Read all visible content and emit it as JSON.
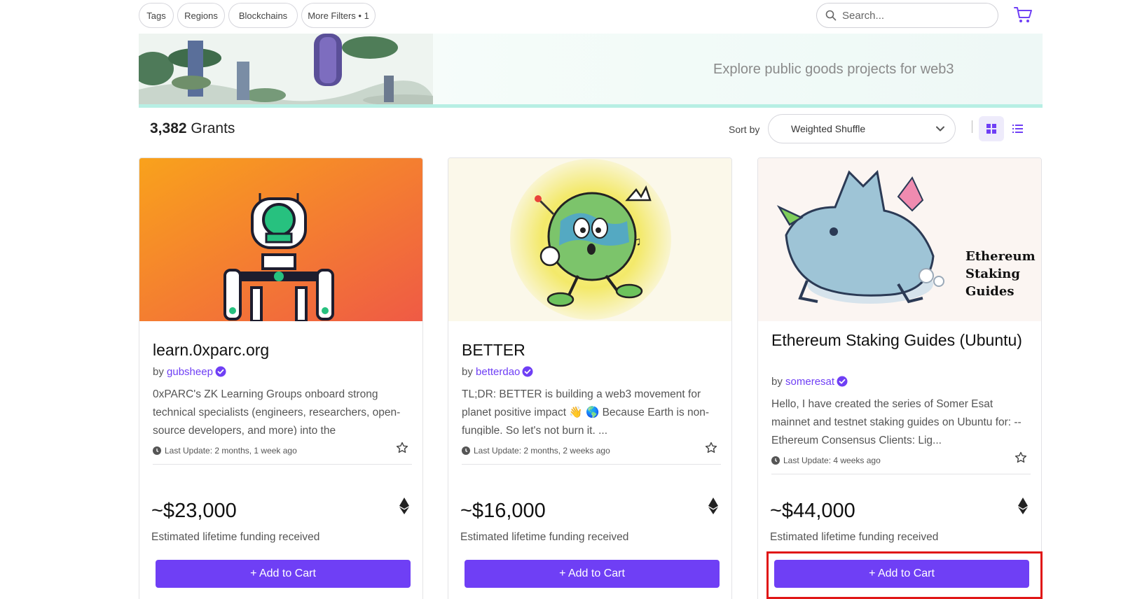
{
  "filters": {
    "tags": "Tags",
    "regions": "Regions",
    "blockchains": "Blockchains",
    "more_filters": "More Filters • 1"
  },
  "search": {
    "placeholder": "Search..."
  },
  "banner": {
    "subtitle": "Explore public goods projects for web3"
  },
  "grants": {
    "count": "3,382",
    "label": "Grants"
  },
  "sort": {
    "label": "Sort by",
    "selected": "Weighted Shuffle"
  },
  "colors": {
    "accent": "#6f3ff5",
    "highlight": "#e01717",
    "banner_line": "#b7efe4"
  },
  "cards": [
    {
      "title": "learn.0xparc.org",
      "by": "by",
      "owner": "gubsheep",
      "description": "0xPARC's ZK Learning Groups onboard strong technical specialists (engineers, researchers, open-source developers, and more) into the",
      "last_update": "Last Update: 2 months, 1 week ago",
      "amount": "~$23,000",
      "amount_label": "Estimated lifetime funding received",
      "button": "+ Add to Cart"
    },
    {
      "title": "BETTER",
      "by": "by",
      "owner": "betterdao",
      "description": "TL;DR: BETTER is building a web3 movement for planet positive impact 👋 🌎 Because Earth is non-fungible. So let's not burn it.   ...",
      "last_update": "Last Update: 2 months, 2 weeks ago",
      "amount": "~$16,000",
      "amount_label": "Estimated lifetime funding received",
      "button": "+ Add to Cart"
    },
    {
      "title": "Ethereum Staking Guides (Ubuntu)",
      "by": "by",
      "owner": "someresat",
      "description": "Hello, I have created the series of Somer Esat mainnet and testnet staking guides on Ubuntu for: -- Ethereum Consensus Clients: Lig...",
      "last_update": "Last Update: 4 weeks ago",
      "amount": "~$44,000",
      "amount_label": "Estimated lifetime funding received",
      "button": "+ Add to Cart",
      "image_text": [
        "Ethereum",
        "Staking",
        "Guides"
      ]
    }
  ]
}
